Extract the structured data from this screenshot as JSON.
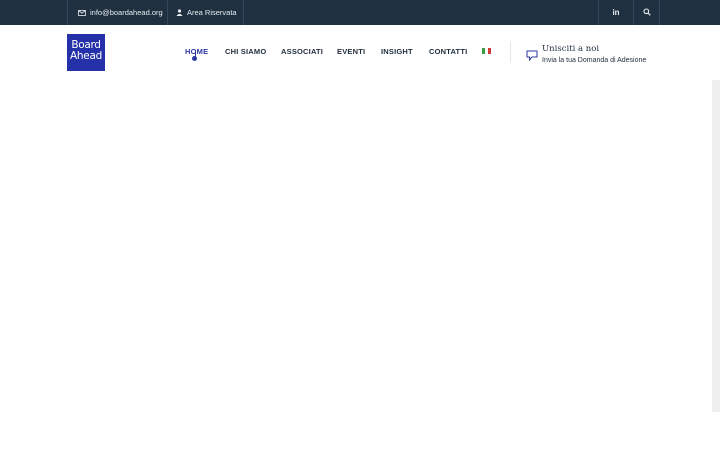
{
  "topbar": {
    "email": "info@boardahead.org",
    "area": "Area Riservata",
    "social": "in"
  },
  "logo": {
    "line1": "Board",
    "line2": "Ahead"
  },
  "nav": {
    "items": [
      {
        "label": "HOME",
        "active": true
      },
      {
        "label": "CHI SIAMO"
      },
      {
        "label": "ASSOCIATI"
      },
      {
        "label": "EVENTI"
      },
      {
        "label": "INSIGHT"
      },
      {
        "label": "CONTATTI"
      }
    ],
    "language_flag": "italy-flag-icon"
  },
  "join": {
    "title": "Unisciti a noi",
    "subtitle": "Invia la tua Domanda di Adesione"
  },
  "colors": {
    "topbar": "#1f3040",
    "accent": "#2c3aa0",
    "logo_bg": "#2431a8"
  }
}
